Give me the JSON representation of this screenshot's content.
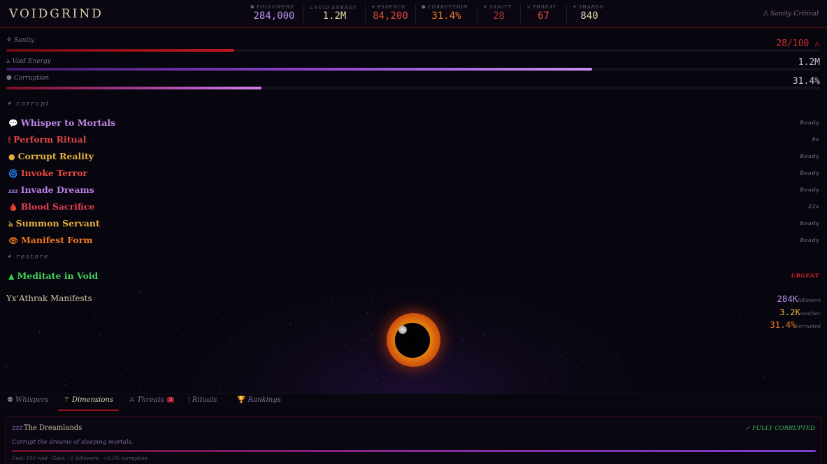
{
  "app": {
    "title": "VOIDGRIND"
  },
  "header": {
    "stats": [
      {
        "icon": "⚉",
        "label": "FOLLOWERS",
        "value": "284,000",
        "color": "#b890e8"
      },
      {
        "icon": "ঌ",
        "label": "VOID ENERGY",
        "value": "1.2M",
        "color": "#e6d6a0"
      },
      {
        "icon": "⚘",
        "label": "ESSENCE",
        "value": "84,200",
        "color": "#d84a3a"
      },
      {
        "icon": "⬢",
        "label": "CORRUPTION",
        "value": "31.4%",
        "color": "#e87a2a"
      },
      {
        "icon": "⚘",
        "label": "SANITY",
        "value": "28",
        "color": "#b0303a"
      },
      {
        "icon": "⚔",
        "label": "THREAT",
        "value": "67",
        "color": "#d8503a"
      },
      {
        "icon": "⚘",
        "label": "SHARDS",
        "value": "840",
        "color": "#e0d6b0"
      }
    ],
    "alert": "⚠ Sanity Critical"
  },
  "bars": [
    {
      "icon": "⚘",
      "label": "Sanity",
      "value": "28/100 ⚠",
      "value_color": "#c8302e",
      "fill": 0.28,
      "fill_css": "linear-gradient(90deg,#6a0a12,#c01820)"
    },
    {
      "icon": "ঌ",
      "label": "Void Energy",
      "value": "1.2M",
      "value_color": "#c9c0d4",
      "fill": 0.72,
      "fill_css": "linear-gradient(90deg,#3a1a66,#8a40c8,#c890f0)"
    },
    {
      "icon": "⬢",
      "label": "Corruption",
      "value": "31.4%",
      "value_color": "#c9c0d4",
      "fill": 0.314,
      "fill_css": "linear-gradient(90deg,#7a1020,#a03a90,#d080f0)"
    }
  ],
  "sections": {
    "corrupt": "✦ corrupt",
    "restore": "✦ restore"
  },
  "actions": [
    {
      "icon": "💬",
      "name": "Whisper to Mortals",
      "status": "Ready",
      "color": "#c08ae8"
    },
    {
      "icon": "🕯",
      "name": "Perform Ritual",
      "status": "8s",
      "color": "#e04848"
    },
    {
      "icon": "●",
      "name": "Corrupt Reality",
      "status": "Ready",
      "color": "#e0b040"
    },
    {
      "icon": "🌀",
      "name": "Invoke Terror",
      "status": "Ready",
      "color": "#e84a40"
    },
    {
      "icon": "zzz",
      "name": "Invade Dreams",
      "status": "Ready",
      "color": "#b780ea"
    },
    {
      "icon": "🩸",
      "name": "Blood Sacrifice",
      "status": "22s",
      "color": "#e04050"
    },
    {
      "icon": "ঌ",
      "name": "Summon Servant",
      "status": "Ready",
      "color": "#e0b040"
    },
    {
      "icon": "👁",
      "name": "Manifest Form",
      "status": "Ready",
      "color": "#f07a20"
    }
  ],
  "restore_actions": [
    {
      "icon": "▲",
      "name": "Meditate in Void",
      "status": "URGENT",
      "color": "#3ed05a",
      "status_color": "#d82a2a"
    }
  ],
  "manifest": {
    "title": "Yx'Athrak Manifests",
    "stats": [
      {
        "value": "284K",
        "unit": "followers",
        "color": "#b890e8"
      },
      {
        "value": "3.2K",
        "unit": "void/sec",
        "color": "#e0b040"
      },
      {
        "value": "31.4%",
        "unit": "corrupted",
        "color": "#f07a20"
      }
    ]
  },
  "tabs": [
    {
      "icon": "⚉",
      "label": "Whispers",
      "active": false
    },
    {
      "icon": "⚚",
      "label": "Dimensions",
      "active": true
    },
    {
      "icon": "⚔",
      "label": "Threats",
      "active": false,
      "badge": "3"
    },
    {
      "icon": "🕯",
      "label": "Rituals",
      "active": false
    },
    {
      "icon": "🏆",
      "label": "Rankings",
      "active": false
    }
  ],
  "dimension": {
    "icon": "zzz",
    "name": "The Dreamlands",
    "status": "✓ FULLY CORRUPTED",
    "description": "Corrupt the dreams of sleeping mortals.",
    "progress": 1.0,
    "cost": "Cost: 100 void · Gain: ~5 followers · +0.5% corruption"
  }
}
